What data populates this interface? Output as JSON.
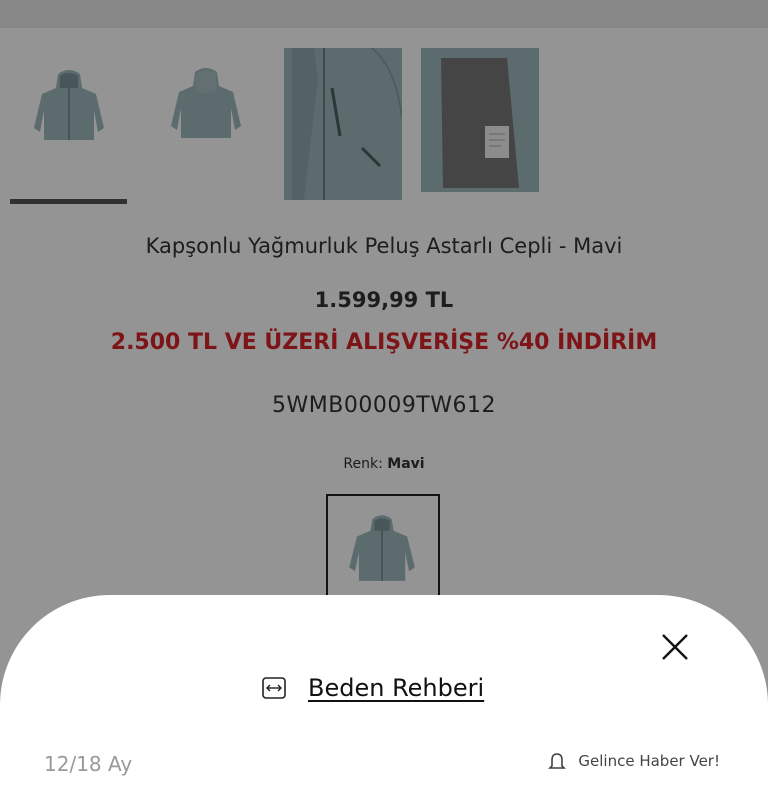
{
  "product": {
    "title": "Kapşonlu Yağmurluk Peluş Astarlı Cepli - Mavi",
    "price": "1.599,99 TL",
    "promo": "2.500 TL VE ÜZERİ ALIŞVERİŞE %40 İNDİRİM",
    "sku": "5WMB00009TW612",
    "color_label": "Renk:",
    "color_value": "Mavi"
  },
  "gallery": {
    "images": [
      "jacket-front",
      "jacket-back",
      "jacket-detail-zip",
      "jacket-lining"
    ],
    "selected_index": 0
  },
  "sheet": {
    "size_guide_label": "Beden Rehberi",
    "size_guide_icon": "ruler-arrows-icon",
    "close_icon": "close-icon",
    "sizes": [
      {
        "label": "12/18 Ay",
        "notify_label": "Gelince Haber Ver!",
        "notify_icon": "bell-icon"
      }
    ]
  },
  "colors": {
    "promo": "#d8232a",
    "jacket": "#9fb8bd",
    "overlay": "rgba(0,0,0,0.42)"
  }
}
